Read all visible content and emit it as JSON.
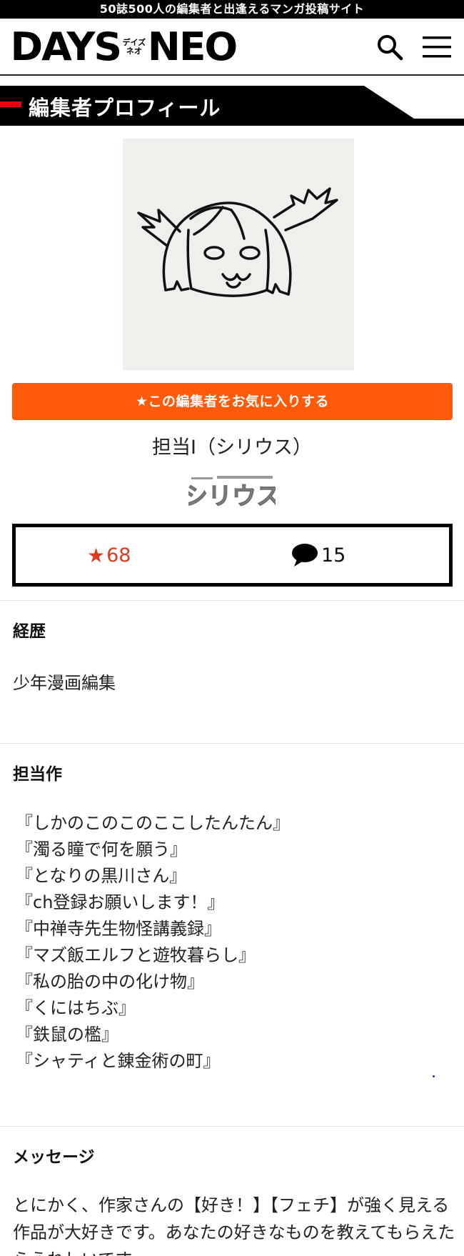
{
  "banner": {
    "text": "50誌500人の編集者と出逢えるマンガ投稿サイト"
  },
  "header": {
    "logo_left": "DAYS",
    "logo_kana_top": "デイズ",
    "logo_kana_bottom": "ネオ",
    "logo_right": "NEO",
    "search_icon": "search-icon",
    "menu_icon": "hamburger-menu-icon"
  },
  "section": {
    "title": "編集者プロフィール"
  },
  "profile": {
    "favorite_button": "★この編集者をお気に入りする",
    "name": "担当I（シリウス）",
    "magazine_logo": "シリウス",
    "stats": {
      "favorites_star": "★",
      "favorites": "68",
      "comment_icon": "speech-bubble-icon",
      "comments": "15"
    }
  },
  "career": {
    "heading": "経歴",
    "text": "少年漫画編集"
  },
  "works": {
    "heading": "担当作",
    "items": [
      "『しかのこのこのここしたんたん』",
      "『濁る瞳で何を願う』",
      "『となりの黒川さん』",
      "『ch登録お願いします！』",
      "『中禅寺先生物怪講義録』",
      "『マズ飯エルフと遊牧暮らし』",
      "『私の胎の中の化け物』",
      "『くにはちぶ』",
      "『鉄鼠の檻』",
      "『シャティと錬金術の町』"
    ]
  },
  "message": {
    "heading": "メッセージ",
    "text": "とにかく、作家さんの【好き！】【フェチ】が強く見える作品が大好きです。あなたの好きなものを教えてもらえたらうれしいです"
  },
  "colors": {
    "accent_orange": "#ff5a0a",
    "accent_red": "#e60012",
    "star_red": "#e03a1e",
    "banner_black": "#000000"
  }
}
